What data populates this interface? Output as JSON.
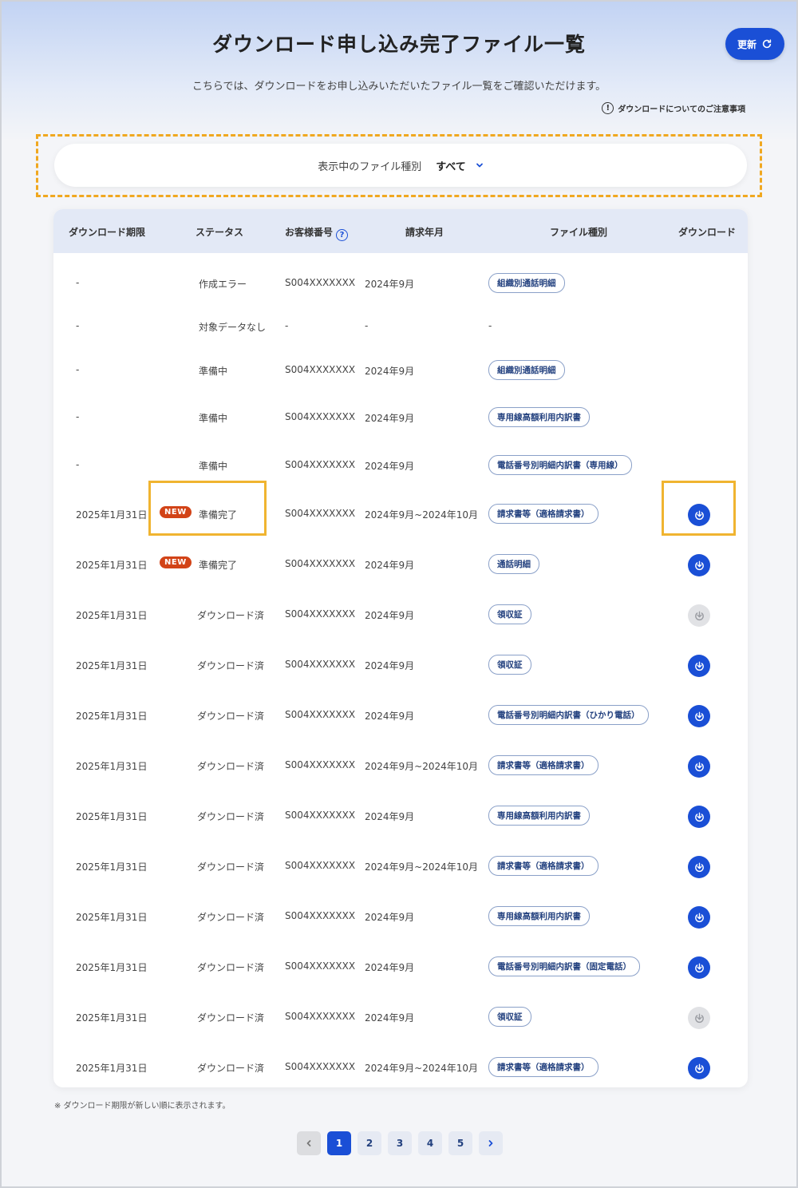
{
  "header": {
    "title": "ダウンロード申し込み完了ファイル一覧",
    "refresh_label": "更新",
    "subtitle": "こちらでは、ダウンロードをお申し込みいただいたファイル一覧をご確認いただけます。",
    "notice_link": "ダウンロードについてのご注意事項"
  },
  "filter": {
    "label": "表示中のファイル種別",
    "value": "すべて"
  },
  "table": {
    "columns": [
      "ダウンロード期限",
      "ステータス",
      "お客様番号",
      "請求年月",
      "ファイル種別",
      "ダウンロード"
    ],
    "rows": [
      {
        "deadline": "-",
        "new": false,
        "status": "作成エラー",
        "customer": "S004XXXXXXX",
        "period": "2024年9月",
        "type": "組織別通話明細",
        "download": "none"
      },
      {
        "deadline": "-",
        "new": false,
        "status": "対象データなし",
        "customer": "-",
        "period": "-",
        "type": "-",
        "download": "none"
      },
      {
        "deadline": "-",
        "new": false,
        "status": "準備中",
        "customer": "S004XXXXXXX",
        "period": "2024年9月",
        "type": "組織別通話明細",
        "download": "none"
      },
      {
        "deadline": "-",
        "new": false,
        "status": "準備中",
        "customer": "S004XXXXXXX",
        "period": "2024年9月",
        "type": "専用線高額利用内訳書",
        "download": "none"
      },
      {
        "deadline": "-",
        "new": false,
        "status": "準備中",
        "customer": "S004XXXXXXX",
        "period": "2024年9月",
        "type": "電話番号別明細内訳書（専用線）",
        "download": "none"
      },
      {
        "deadline": "2025年1月31日",
        "new": true,
        "status": "準備完了",
        "customer": "S004XXXXXXX",
        "period": "2024年9月~2024年10月",
        "type": "請求書等（適格請求書）",
        "download": "active"
      },
      {
        "deadline": "2025年1月31日",
        "new": true,
        "status": "準備完了",
        "customer": "S004XXXXXXX",
        "period": "2024年9月",
        "type": "通話明細",
        "download": "active"
      },
      {
        "deadline": "2025年1月31日",
        "new": false,
        "status": "ダウンロード済",
        "customer": "S004XXXXXXX",
        "period": "2024年9月",
        "type": "領収証",
        "download": "disabled"
      },
      {
        "deadline": "2025年1月31日",
        "new": false,
        "status": "ダウンロード済",
        "customer": "S004XXXXXXX",
        "period": "2024年9月",
        "type": "領収証",
        "download": "active"
      },
      {
        "deadline": "2025年1月31日",
        "new": false,
        "status": "ダウンロード済",
        "customer": "S004XXXXXXX",
        "period": "2024年9月",
        "type": "電話番号別明細内訳書（ひかり電話）",
        "download": "active"
      },
      {
        "deadline": "2025年1月31日",
        "new": false,
        "status": "ダウンロード済",
        "customer": "S004XXXXXXX",
        "period": "2024年9月~2024年10月",
        "type": "請求書等（適格請求書）",
        "download": "active"
      },
      {
        "deadline": "2025年1月31日",
        "new": false,
        "status": "ダウンロード済",
        "customer": "S004XXXXXXX",
        "period": "2024年9月",
        "type": "専用線高額利用内訳書",
        "download": "active"
      },
      {
        "deadline": "2025年1月31日",
        "new": false,
        "status": "ダウンロード済",
        "customer": "S004XXXXXXX",
        "period": "2024年9月~2024年10月",
        "type": "請求書等（適格請求書）",
        "download": "active"
      },
      {
        "deadline": "2025年1月31日",
        "new": false,
        "status": "ダウンロード済",
        "customer": "S004XXXXXXX",
        "period": "2024年9月",
        "type": "専用線高額利用内訳書",
        "download": "active"
      },
      {
        "deadline": "2025年1月31日",
        "new": false,
        "status": "ダウンロード済",
        "customer": "S004XXXXXXX",
        "period": "2024年9月",
        "type": "電話番号別明細内訳書（固定電話）",
        "download": "active"
      },
      {
        "deadline": "2025年1月31日",
        "new": false,
        "status": "ダウンロード済",
        "customer": "S004XXXXXXX",
        "period": "2024年9月",
        "type": "領収証",
        "download": "disabled"
      },
      {
        "deadline": "2025年1月31日",
        "new": false,
        "status": "ダウンロード済",
        "customer": "S004XXXXXXX",
        "period": "2024年9月~2024年10月",
        "type": "請求書等（適格請求書）",
        "download": "active"
      }
    ],
    "new_badge_label": "NEW"
  },
  "footnote": "※ ダウンロード期限が新しい順に表示されます。",
  "pagination": {
    "pages": [
      "1",
      "2",
      "3",
      "4",
      "5"
    ],
    "current": "1"
  },
  "colors": {
    "accent": "#1a4fd6",
    "new_badge": "#d24317",
    "highlight": "#f0a820",
    "table_header": "#e3e9f6"
  },
  "icons": {
    "refresh": "refresh-icon",
    "info": "info-icon",
    "help": "help-icon",
    "chevron": "chevron-down-icon",
    "download": "download-icon",
    "prev": "chevron-left-icon",
    "next": "chevron-right-icon"
  }
}
